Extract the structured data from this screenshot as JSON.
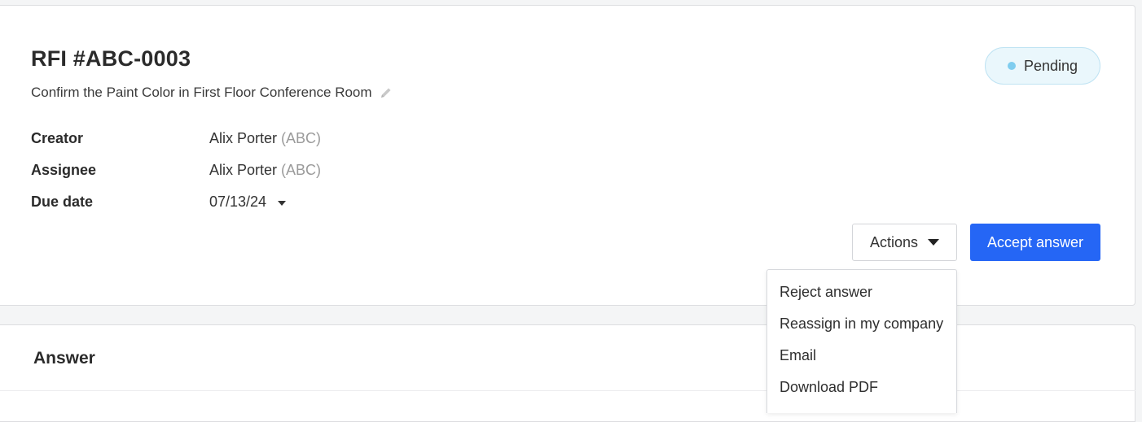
{
  "rfi": {
    "title": "RFI #ABC-0003",
    "subtitle": "Confirm the Paint Color in First Floor Conference Room",
    "status": "Pending"
  },
  "fields": {
    "creator": {
      "label": "Creator",
      "name": "Alix Porter",
      "company": "(ABC)"
    },
    "assignee": {
      "label": "Assignee",
      "name": "Alix Porter",
      "company": "(ABC)"
    },
    "due_date": {
      "label": "Due date",
      "value": "07/13/24"
    }
  },
  "buttons": {
    "actions_label": "Actions",
    "accept_label": "Accept answer"
  },
  "actions_menu": [
    "Reject answer",
    "Reassign in my company",
    "Email",
    "Download PDF"
  ],
  "answer": {
    "heading": "Answer"
  },
  "colors": {
    "primary": "#2566f5",
    "status_dot": "#7fcdef",
    "status_bg": "#eaf7fc"
  },
  "icons": [
    "pencil-icon",
    "caret-down-icon"
  ]
}
